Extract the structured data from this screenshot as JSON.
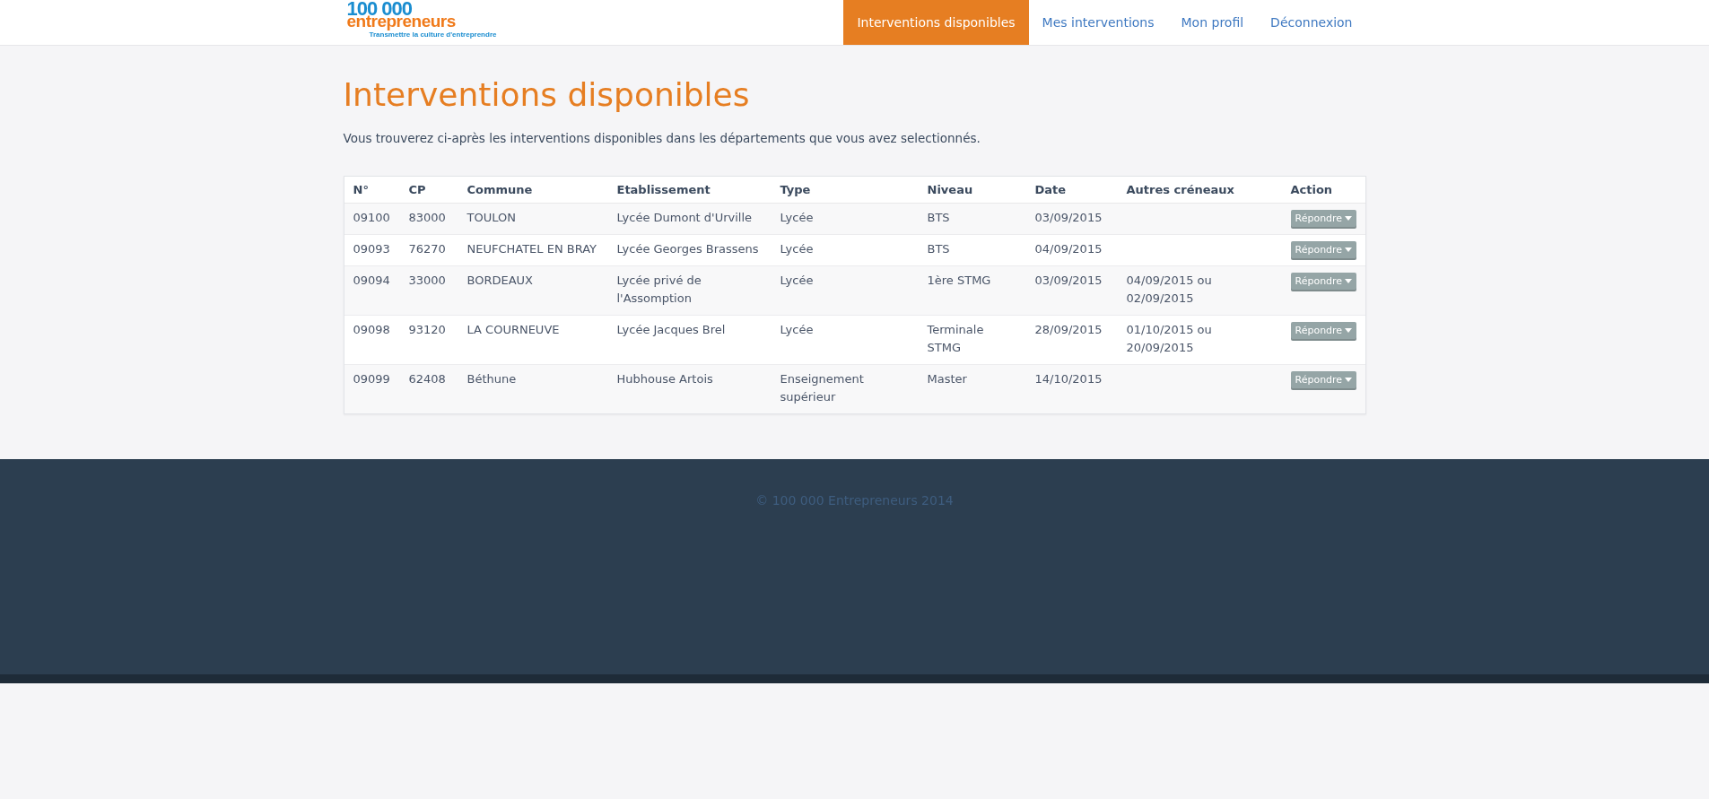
{
  "logo": {
    "number": "100 000",
    "word": "entrepreneurs",
    "tagline": "Transmettre la culture d'entreprendre"
  },
  "nav": [
    {
      "label": "Interventions disponibles",
      "selected": true
    },
    {
      "label": "Mes interventions",
      "selected": false
    },
    {
      "label": "Mon profil",
      "selected": false
    },
    {
      "label": "Déconnexion",
      "selected": false
    }
  ],
  "page_title": "Interventions disponibles",
  "intro": "Vous trouverez ci-après les interventions disponibles dans les départements que vous avez selectionnés.",
  "table": {
    "columns": [
      "N°",
      "CP",
      "Commune",
      "Etablissement",
      "Type",
      "Niveau",
      "Date",
      "Autres créneaux",
      "Action"
    ],
    "rows": [
      {
        "cells": [
          "09100",
          "83000",
          "TOULON",
          "Lycée Dumont d'Urville",
          "Lycée",
          "BTS",
          "03/09/2015",
          ""
        ],
        "action": "Répondre"
      },
      {
        "cells": [
          "09093",
          "76270",
          "NEUFCHATEL EN BRAY",
          "Lycée Georges Brassens",
          "Lycée",
          "BTS",
          "04/09/2015",
          ""
        ],
        "action": "Répondre"
      },
      {
        "cells": [
          "09094",
          "33000",
          "BORDEAUX",
          "Lycée privé de l'Assomption",
          "Lycée",
          "1ère STMG",
          "03/09/2015",
          "04/09/2015 ou 02/09/2015"
        ],
        "action": "Répondre"
      },
      {
        "cells": [
          "09098",
          "93120",
          "LA COURNEUVE",
          "Lycée Jacques Brel",
          "Lycée",
          "Terminale STMG",
          "28/09/2015",
          "01/10/2015 ou 20/09/2015"
        ],
        "action": "Répondre"
      },
      {
        "cells": [
          "09099",
          "62408",
          "Béthune",
          "Hubhouse Artois",
          "Enseignement supérieur",
          "Master",
          "14/10/2015",
          ""
        ],
        "action": "Répondre"
      }
    ]
  },
  "footer": "© 100 000 Entrepreneurs 2014"
}
